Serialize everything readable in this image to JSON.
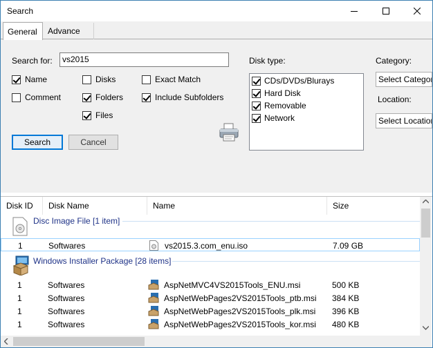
{
  "window": {
    "title": "Search"
  },
  "tabs": [
    {
      "label": "General"
    },
    {
      "label": "Advance"
    }
  ],
  "search": {
    "label": "Search for:",
    "value": "vs2015"
  },
  "options": {
    "name": "Name",
    "disks": "Disks",
    "exact_match": "Exact Match",
    "comment": "Comment",
    "folders": "Folders",
    "include_subfolders": "Include Subfolders",
    "files": "Files"
  },
  "buttons": {
    "search": "Search",
    "cancel": "Cancel"
  },
  "disk_type": {
    "label": "Disk type:",
    "items": [
      "CDs/DVDs/Blurays",
      "Hard Disk",
      "Removable",
      "Network"
    ]
  },
  "category": {
    "label": "Category:",
    "value": "Select Category"
  },
  "location": {
    "label": "Location:",
    "value": "Select Location"
  },
  "table": {
    "headers": [
      "Disk ID",
      "Disk Name",
      "Name",
      "Size"
    ],
    "groups": [
      {
        "title": "Disc Image File [1 item]",
        "rows": [
          {
            "id": "1",
            "disk": "Softwares",
            "name": "vs2015.3.com_enu.iso",
            "size": "7.09 GB"
          }
        ]
      },
      {
        "title": "Windows Installer Package [28 items]",
        "rows": [
          {
            "id": "1",
            "disk": "Softwares",
            "name": "AspNetMVC4VS2015Tools_ENU.msi",
            "size": "500 KB"
          },
          {
            "id": "1",
            "disk": "Softwares",
            "name": "AspNetWebPages2VS2015Tools_ptb.msi",
            "size": "384 KB"
          },
          {
            "id": "1",
            "disk": "Softwares",
            "name": "AspNetWebPages2VS2015Tools_plk.msi",
            "size": "396 KB"
          },
          {
            "id": "1",
            "disk": "Softwares",
            "name": "AspNetWebPages2VS2015Tools_kor.msi",
            "size": "480 KB"
          }
        ]
      }
    ]
  },
  "colors": {
    "accent": "#0078d7",
    "group_text": "#1e3287",
    "selection": "#99d1ff"
  }
}
